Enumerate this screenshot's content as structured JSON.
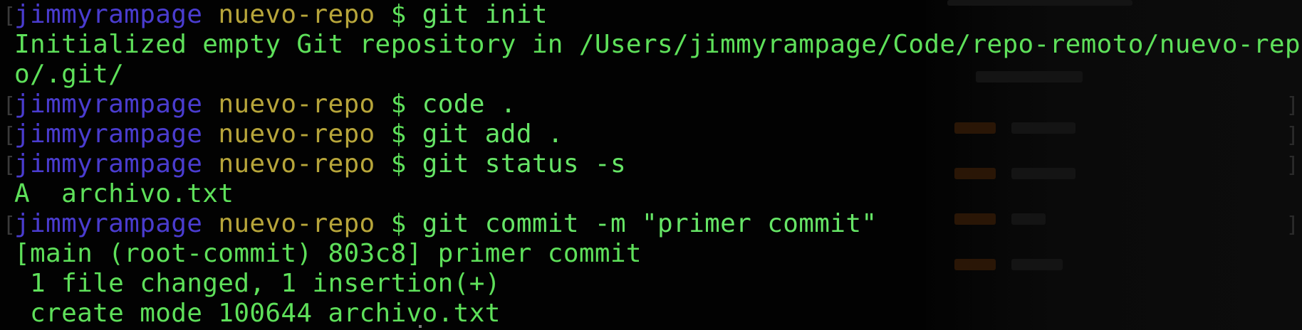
{
  "terminal": {
    "lines": [
      {
        "type": "prompt",
        "user": "jimmyrampage",
        "dir": "nuevo-repo",
        "symbol": "$",
        "command": "git init"
      },
      {
        "type": "output",
        "text": "Initialized empty Git repository in /Users/jimmyrampage/Code/repo-remoto/nuevo-rep"
      },
      {
        "type": "output",
        "text": "o/.git/"
      },
      {
        "type": "prompt",
        "user": "jimmyrampage",
        "dir": "nuevo-repo",
        "symbol": "$",
        "command": "code ."
      },
      {
        "type": "prompt",
        "user": "jimmyrampage",
        "dir": "nuevo-repo",
        "symbol": "$",
        "command": "git add ."
      },
      {
        "type": "prompt",
        "user": "jimmyrampage",
        "dir": "nuevo-repo",
        "symbol": "$",
        "command": "git status -s"
      },
      {
        "type": "output",
        "text": "A  archivo.txt"
      },
      {
        "type": "prompt",
        "user": "jimmyrampage",
        "dir": "nuevo-repo",
        "symbol": "$",
        "command": "git commit -m \"primer commit\""
      },
      {
        "type": "output",
        "text": "[main (root-commit) 803c8] primer commit"
      },
      {
        "type": "output",
        "text": " 1 file changed, 1 insertion(+)"
      },
      {
        "type": "output",
        "text": " create mode 100644 archivo.txt"
      }
    ],
    "colors": {
      "background": "#020202",
      "user": "#4a3ccf",
      "directory": "#b7a53a",
      "text": "#5ee05a"
    }
  }
}
